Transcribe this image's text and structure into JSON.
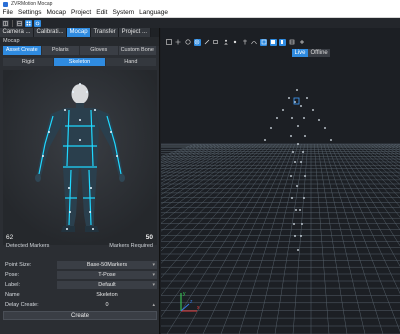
{
  "window": {
    "title": "ZVRMotion Mocap"
  },
  "menu": [
    "File",
    "Settings",
    "Mocap",
    "Project",
    "Edit",
    "System",
    "Language"
  ],
  "toolbar": {
    "buttons": [
      "layout-icon",
      "split-view-icon",
      "grid-view-icon",
      "sync-icon"
    ]
  },
  "left_panel": {
    "tabs": [
      {
        "label": "Camera ...",
        "active": false
      },
      {
        "label": "Calibrati...",
        "active": false
      },
      {
        "label": "Mocap",
        "active": true
      },
      {
        "label": "Transfer",
        "active": false
      },
      {
        "label": "Project ...",
        "active": false
      }
    ],
    "section_label": "Mocap",
    "asset_types": [
      {
        "label": "Asset Create",
        "active": true
      },
      {
        "label": "Polaris",
        "active": false
      },
      {
        "label": "Gloves",
        "active": false
      },
      {
        "label": "Custom Bone",
        "active": false
      }
    ],
    "body_types": [
      {
        "label": "Rigid",
        "active": false
      },
      {
        "label": "Skeleton",
        "active": true
      },
      {
        "label": "Hand",
        "active": false
      }
    ],
    "detected_markers_count": "62",
    "required_markers_count": "50",
    "detected_markers_label": "Detected Markers",
    "required_markers_label": "Markers Required",
    "form": {
      "point_size_label": "Point Size:",
      "point_size_value": "Base-50Markers",
      "pose_label": "Pose:",
      "pose_value": "T-Pose",
      "label_label": "Label:",
      "label_value": "Default",
      "name_label": "Name",
      "name_value": "Skeleton",
      "delay_label": "Delay Create:",
      "delay_value": "0",
      "create_label": "Create"
    }
  },
  "viewport": {
    "live_label": "Live",
    "offline_label": "Offline",
    "mode": "Live",
    "axes": [
      "x",
      "y",
      "z"
    ],
    "colors": {
      "accent": "#2f8be0",
      "suit_trim": "#1fd8ff",
      "axis_x": "#e23a3a",
      "axis_y": "#3ad85a",
      "axis_z": "#3a7ae2"
    }
  }
}
